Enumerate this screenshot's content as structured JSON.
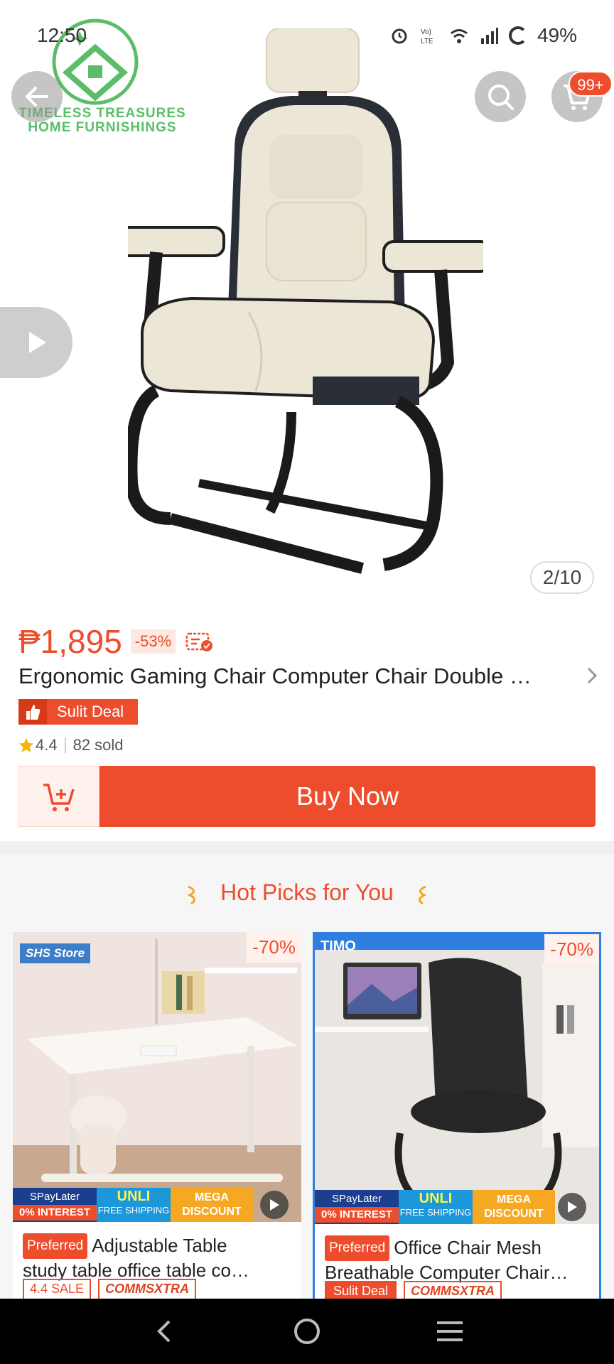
{
  "status_bar": {
    "time": "12:50",
    "battery": "49%"
  },
  "store_logo": {
    "line1": "TIMELESS TREASURES",
    "line2": "HOME FURNISHINGS"
  },
  "header": {
    "cart_badge": "99+"
  },
  "gallery": {
    "counter": "2/10"
  },
  "product": {
    "price": "₱1,895",
    "discount": "-53%",
    "title": "Ergonomic Gaming Chair Computer Chair Double …",
    "deal_label": "Sulit Deal",
    "rating": "4.4",
    "sold": "82 sold"
  },
  "actions": {
    "buy_now": "Buy Now"
  },
  "hot_picks": {
    "title": "Hot Picks for You",
    "cards": [
      {
        "discount": "-70%",
        "store": "SHS Store",
        "preferred": "Preferred",
        "name_line1": "Adjustable Table",
        "name_line2": "study table office table co…",
        "tag1": "4.4 SALE",
        "tag2": "COMMSXTRA",
        "promo": {
          "spay_top": "SPayLater",
          "spay_bottom": "0% INTEREST",
          "unli_big": "UNLI",
          "unli_small": "FREE SHIPPING",
          "mega": "MEGA DISCOUNT"
        }
      },
      {
        "discount": "-70%",
        "store": "TIMO",
        "preferred": "Preferred",
        "name_line1": "Office Chair Mesh",
        "name_line2": "Breathable Computer Chair…",
        "tag1": "Sulit Deal",
        "tag2": "COMMSXTRA",
        "promo": {
          "spay_top": "SPayLater",
          "spay_bottom": "0% INTEREST",
          "unli_big": "UNLI",
          "unli_small": "FREE SHIPPING",
          "mega": "MEGA DISCOUNT"
        }
      }
    ]
  },
  "colors": {
    "accent": "#ee4d2d",
    "logo_green": "#5cbd68"
  }
}
